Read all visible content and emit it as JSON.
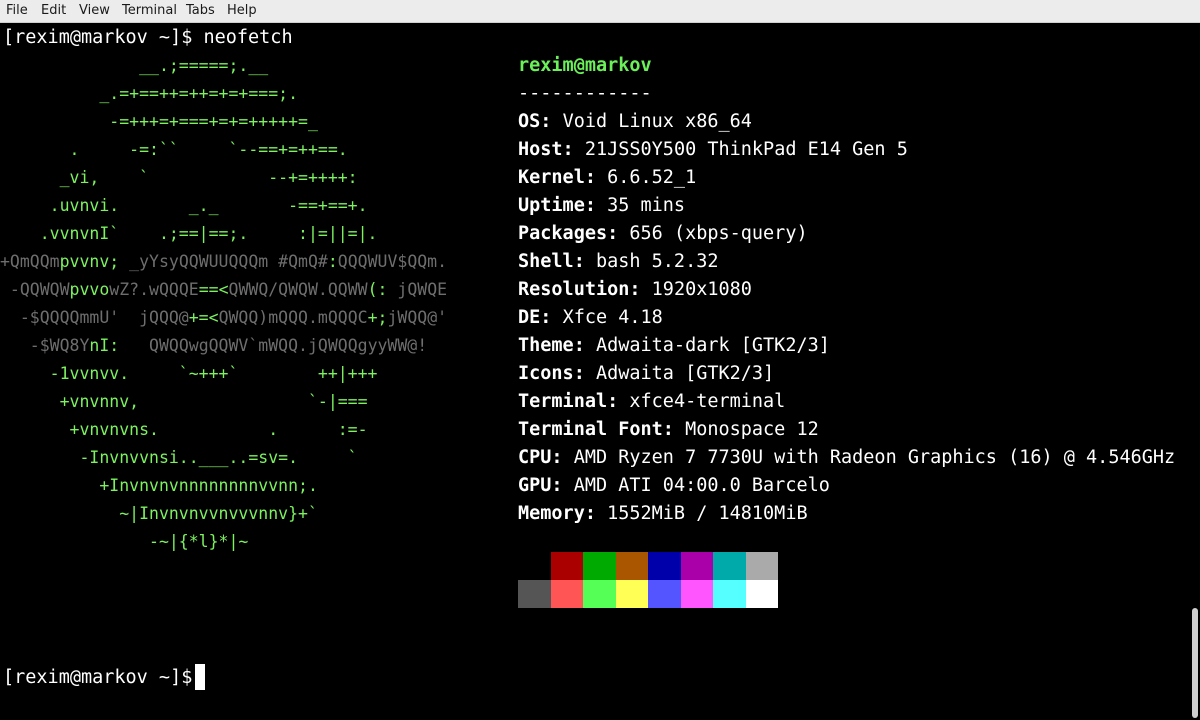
{
  "menu": [
    "File",
    "Edit",
    "View",
    "Terminal",
    "Tabs",
    "Help"
  ],
  "prompt": "[rexim@markov ~]$",
  "command_line": "[rexim@markov ~]$ neofetch",
  "logo": {
    "l0": "              __.;=====;.__",
    "l1": "          _.=+==++=++=+=+===;.",
    "l2": "           -=+++=+===+=+=+++++=_",
    "l3": "       .     -=:``     `--==+=++==.",
    "l4": "      _vi,    `            --+=++++:",
    "l5": "     .uvnvi.       _._       -==+==+.",
    "l6a": "    .vvnvnI`    .;==|==;.     :|=||=|.",
    "l7a": "+QmQQm",
    "l7b": "pvvnv;",
    "l7c": " _yYsyQQWUUQQQm #QmQ#",
    "l7d": ":",
    "l7e": "QQQWUV$QQm.",
    "l8a": " -QQWQW",
    "l8b": "pvvo",
    "l8c": "wZ?.wQQQE",
    "l8d": "==<",
    "l8e": "QWWQ/QWQW.QQWW",
    "l8f": "(:",
    "l8g": " jQWQE",
    "l9a": "  -$QQQQmmU'  jQQQ@",
    "l9b": "+=<",
    "l9c": "QWQQ)mQQQ.mQQQC",
    "l9d": "+;",
    "l9e": "jWQQ@'",
    "l10a": "   -$WQ8Y",
    "l10b": "nI:",
    "l10c": "   QWQQwgQQWV`mWQQ.jQWQQgyyWW@!",
    "l11": "     -1vvnvv.     `~+++`        ++|+++",
    "l12": "      +vnvnnv,                 `-|===",
    "l13": "       +vnvnvns.           .      :=-",
    "l14": "        -Invnvvnsi..___..=sv=.     `",
    "l15": "          +Invnvnvnnnnnnnnvvnn;.",
    "l16": "            ~|Invnvnvvnvvvnnv}+`",
    "l17": "               -~|{*l}*|~"
  },
  "info": {
    "userhost": "rexim@markov",
    "separator": "------------",
    "fields": [
      {
        "label": "OS:",
        "value": "Void Linux x86_64"
      },
      {
        "label": "Host:",
        "value": "21JSS0Y500 ThinkPad E14 Gen 5"
      },
      {
        "label": "Kernel:",
        "value": "6.6.52_1"
      },
      {
        "label": "Uptime:",
        "value": "35 mins"
      },
      {
        "label": "Packages:",
        "value": "656 (xbps-query)"
      },
      {
        "label": "Shell:",
        "value": "bash 5.2.32"
      },
      {
        "label": "Resolution:",
        "value": "1920x1080"
      },
      {
        "label": "DE:",
        "value": "Xfce 4.18"
      },
      {
        "label": "Theme:",
        "value": "Adwaita-dark [GTK2/3]"
      },
      {
        "label": "Icons:",
        "value": "Adwaita [GTK2/3]"
      },
      {
        "label": "Terminal:",
        "value": "xfce4-terminal"
      },
      {
        "label": "Terminal Font:",
        "value": "Monospace 12"
      },
      {
        "label": "CPU:",
        "value": "AMD Ryzen 7 7730U with Radeon Graphics (16) @ 4.546GHz"
      },
      {
        "label": "GPU:",
        "value": "AMD ATI 04:00.0 Barcelo"
      },
      {
        "label": "Memory:",
        "value": "1552MiB / 14810MiB"
      }
    ]
  },
  "palette": {
    "normal": [
      "#000000",
      "#aa0000",
      "#00aa00",
      "#aa5500",
      "#0000aa",
      "#aa00aa",
      "#00aaaa",
      "#aaaaaa"
    ],
    "bright": [
      "#555555",
      "#ff5555",
      "#55ff55",
      "#ffff55",
      "#5555ff",
      "#ff55ff",
      "#55ffff",
      "#ffffff"
    ]
  }
}
